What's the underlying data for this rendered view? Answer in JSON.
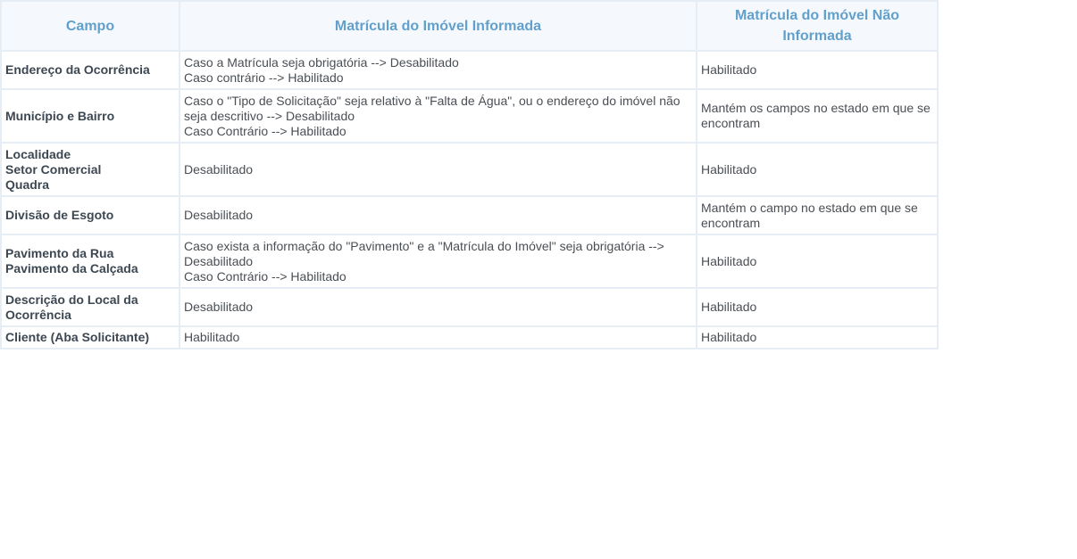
{
  "table": {
    "headers": [
      "Campo",
      "Matrícula do Imóvel Informada",
      "Matrícula do Imóvel Não Informada"
    ],
    "rows": [
      {
        "campo": [
          "Endereço da Ocorrência"
        ],
        "informada": [
          "Caso a Matrícula seja obrigatória --> Desabilitado",
          "Caso contrário --> Habilitado"
        ],
        "nao_informada": [
          "Habilitado"
        ]
      },
      {
        "campo": [
          "Município e Bairro"
        ],
        "informada": [
          "Caso o \"Tipo de Solicitação\" seja relativo à \"Falta de Água\", ou o endereço do imóvel não seja descritivo --> Desabilitado",
          "Caso Contrário --> Habilitado"
        ],
        "nao_informada": [
          "Mantém os campos no estado em que se encontram"
        ]
      },
      {
        "campo": [
          "Localidade",
          "Setor Comercial",
          "Quadra"
        ],
        "informada": [
          "Desabilitado"
        ],
        "nao_informada": [
          "Habilitado"
        ]
      },
      {
        "campo": [
          "Divisão de Esgoto"
        ],
        "informada": [
          "Desabilitado"
        ],
        "nao_informada": [
          "Mantém o campo no estado em que se encontram"
        ]
      },
      {
        "campo": [
          "Pavimento da Rua",
          "Pavimento da Calçada"
        ],
        "informada": [
          "Caso exista a informação do \"Pavimento\" e a \"Matrícula do Imóvel\" seja obrigatória --> Desabilitado",
          "Caso Contrário --> Habilitado"
        ],
        "nao_informada": [
          "Habilitado"
        ]
      },
      {
        "campo": [
          "Descrição do Local da Ocorrência"
        ],
        "informada": [
          "Desabilitado"
        ],
        "nao_informada": [
          "Habilitado"
        ]
      },
      {
        "campo": [
          "Cliente (Aba Solicitante)"
        ],
        "informada": [
          "Habilitado"
        ],
        "nao_informada": [
          "Habilitado"
        ]
      }
    ]
  }
}
